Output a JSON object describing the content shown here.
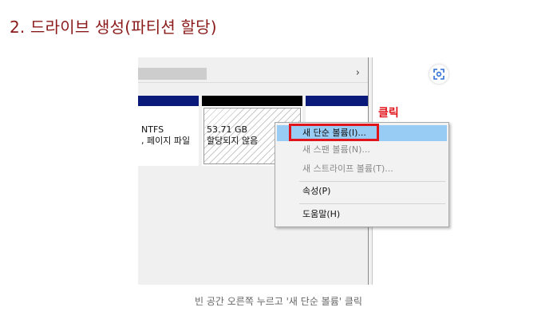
{
  "heading": "2. 드라이브 생성(파티션 할당)",
  "disk_view": {
    "partition1": {
      "fs": "NTFS",
      "status": ", 페이지 파일"
    },
    "partition2": {
      "size": "53.71 GB",
      "status": "할당되지 않음"
    }
  },
  "context_menu": {
    "items": [
      {
        "label": "새 단순 볼륨(I)...",
        "state": "highlighted"
      },
      {
        "label": "새 스팬 볼륨(N)...",
        "state": "disabled"
      },
      {
        "label": "새 스트라이프 볼륨(T)...",
        "state": "disabled"
      },
      {
        "label": "속성(P)",
        "state": "enabled"
      },
      {
        "label": "도움말(H)",
        "state": "enabled"
      }
    ]
  },
  "annotation": {
    "label": "클릭",
    "color": "#e0151b"
  },
  "caption": "빈 공간 오른쪽 누르고 '새 단순 볼륨' 클릭",
  "colors": {
    "heading": "#8b1a1a",
    "partition_band": "#0a1a7a",
    "unallocated_band": "#000000",
    "menu_highlight": "#99ccf5"
  },
  "icons": {
    "scroll_right": "chevron-right-icon",
    "lens": "google-lens-icon"
  }
}
